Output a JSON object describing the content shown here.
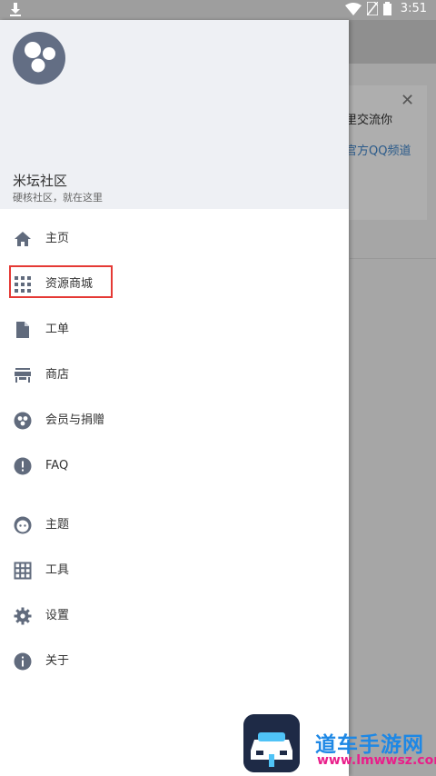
{
  "status_bar": {
    "time": "3:51"
  },
  "background": {
    "notice_line1": "里交流你",
    "notice_line2": "官方QQ频道",
    "close_symbol": "✕"
  },
  "drawer": {
    "site_name": "米坛社区",
    "site_slogan": "硬核社区，就在这里",
    "menu": [
      {
        "label": "主页",
        "icon": "home-icon"
      },
      {
        "label": "资源商城",
        "icon": "grid-icon"
      },
      {
        "label": "工单",
        "icon": "document-icon"
      },
      {
        "label": "商店",
        "icon": "store-icon"
      },
      {
        "label": "会员与捐赠",
        "icon": "membership-icon"
      },
      {
        "label": "FAQ",
        "icon": "alert-icon"
      },
      {
        "label": "主题",
        "icon": "face-icon"
      },
      {
        "label": "工具",
        "icon": "table-icon"
      },
      {
        "label": "设置",
        "icon": "gear-icon"
      },
      {
        "label": "关于",
        "icon": "info-icon"
      }
    ]
  },
  "watermark": {
    "title": "道车手游网",
    "url": "www.lmwwsz.com"
  },
  "colors": {
    "highlight": "#e53935",
    "icon": "#616b7d"
  }
}
